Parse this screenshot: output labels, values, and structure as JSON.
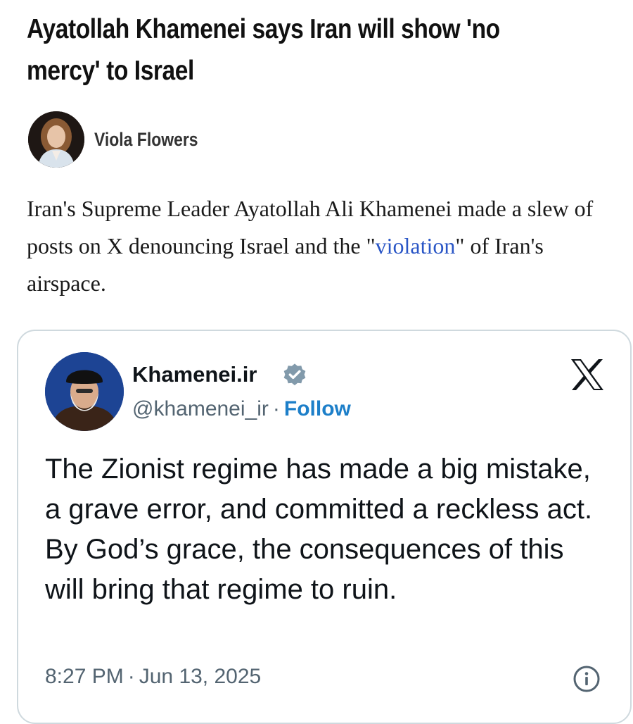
{
  "article": {
    "headline": "Ayatollah Khamenei says Iran will show 'no mercy' to Israel",
    "author": {
      "name": "Viola Flowers",
      "avatar_icon": "author-photo"
    },
    "summary": {
      "before_link": "Iran's Supreme Leader Ayatollah Ali Khamenei made a slew of posts on X denouncing Israel and the \"",
      "link_text": "violation",
      "after_link": "\" of Iran's airspace."
    }
  },
  "tweet": {
    "display_name": "Khamenei.ir",
    "verified": true,
    "handle": "@khamenei_ir",
    "separator": "·",
    "follow_label": "Follow",
    "text": "The Zionist regime has made a big mistake, a grave error, and committed a reckless act. By God’s grace, the consequences of this will bring that regime to ruin.",
    "time": "8:27 PM",
    "date": "Jun 13, 2025",
    "platform_icon": "x-logo-icon",
    "info_icon": "info-icon"
  },
  "colors": {
    "link": "#2a56c6",
    "follow": "#1d7fc9",
    "muted": "#536471",
    "card_border": "#cfd9de",
    "verified_badge": "#829aab"
  }
}
